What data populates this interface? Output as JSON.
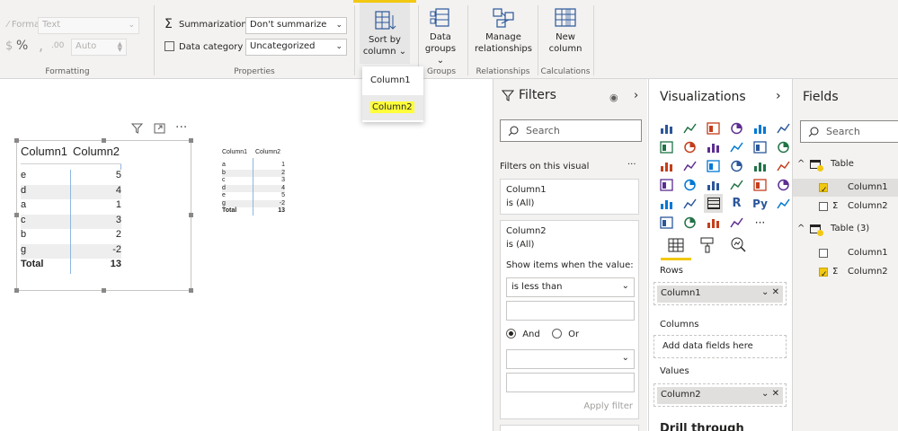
{
  "ribbon": {
    "format_label": "Format",
    "format_value": "Text",
    "percent_symbol": "%",
    "decimals_value": "Auto",
    "formatting_group": "Formatting",
    "summarization_label": "Summarization",
    "summarization_value": "Don't summarize",
    "data_category_label": "Data category",
    "data_category_value": "Uncategorized",
    "properties_group": "Properties",
    "sort_by_line1": "Sort by",
    "sort_by_line2": "column",
    "data_groups_line1": "Data",
    "data_groups_line2": "groups",
    "groups_group": "Groups",
    "manage_rel_line1": "Manage",
    "manage_rel_line2": "relationships",
    "relationships_group": "Relationships",
    "new_column_line1": "New",
    "new_column_line2": "column",
    "calculations_group": "Calculations",
    "accent_color": "#f2c811"
  },
  "sort_menu": {
    "items": [
      "Column1",
      "Column2"
    ],
    "highlight_color": "#ffff3a"
  },
  "table_visual": {
    "headers": [
      "Column1",
      "Column2"
    ],
    "rows": [
      [
        "e",
        "5"
      ],
      [
        "d",
        "4"
      ],
      [
        "a",
        "1"
      ],
      [
        "c",
        "3"
      ],
      [
        "b",
        "2"
      ],
      [
        "g",
        "-2"
      ]
    ],
    "total": [
      "Total",
      "13"
    ]
  },
  "table_visual_small": {
    "headers": [
      "Column1",
      "Column2"
    ],
    "rows": [
      [
        "a",
        "1"
      ],
      [
        "b",
        "2"
      ],
      [
        "c",
        "3"
      ],
      [
        "d",
        "4"
      ],
      [
        "e",
        "5"
      ],
      [
        "g",
        "-2"
      ]
    ],
    "total": [
      "Total",
      "13"
    ]
  },
  "filters": {
    "title": "Filters",
    "search_placeholder": "Search",
    "section": "Filters on this visual",
    "more": "···",
    "card1_field": "Column1",
    "card1_state": "is (All)",
    "card2_field": "Column2",
    "card2_state": "is (All)",
    "show_items": "Show items when the value:",
    "condition": "is less than",
    "and_label": "And",
    "or_label": "Or",
    "apply": "Apply filter"
  },
  "visualizations": {
    "title": "Visualizations",
    "rows_label": "Rows",
    "rows_field": "Column1",
    "columns_label": "Columns",
    "columns_placeholder": "Add data fields here",
    "values_label": "Values",
    "values_field": "Column2",
    "drill_through": "Drill through",
    "more_visuals": "···",
    "icon_r": "R",
    "icon_py": "Py"
  },
  "fields": {
    "title": "Fields",
    "search_placeholder": "Search",
    "tables": [
      {
        "name": "Table",
        "fields": [
          {
            "name": "Column1",
            "sigma": false,
            "checked": true
          },
          {
            "name": "Column2",
            "sigma": true,
            "checked": false
          }
        ]
      },
      {
        "name": "Table (3)",
        "fields": [
          {
            "name": "Column1",
            "sigma": false,
            "checked": false
          },
          {
            "name": "Column2",
            "sigma": true,
            "checked": true
          }
        ]
      }
    ]
  }
}
